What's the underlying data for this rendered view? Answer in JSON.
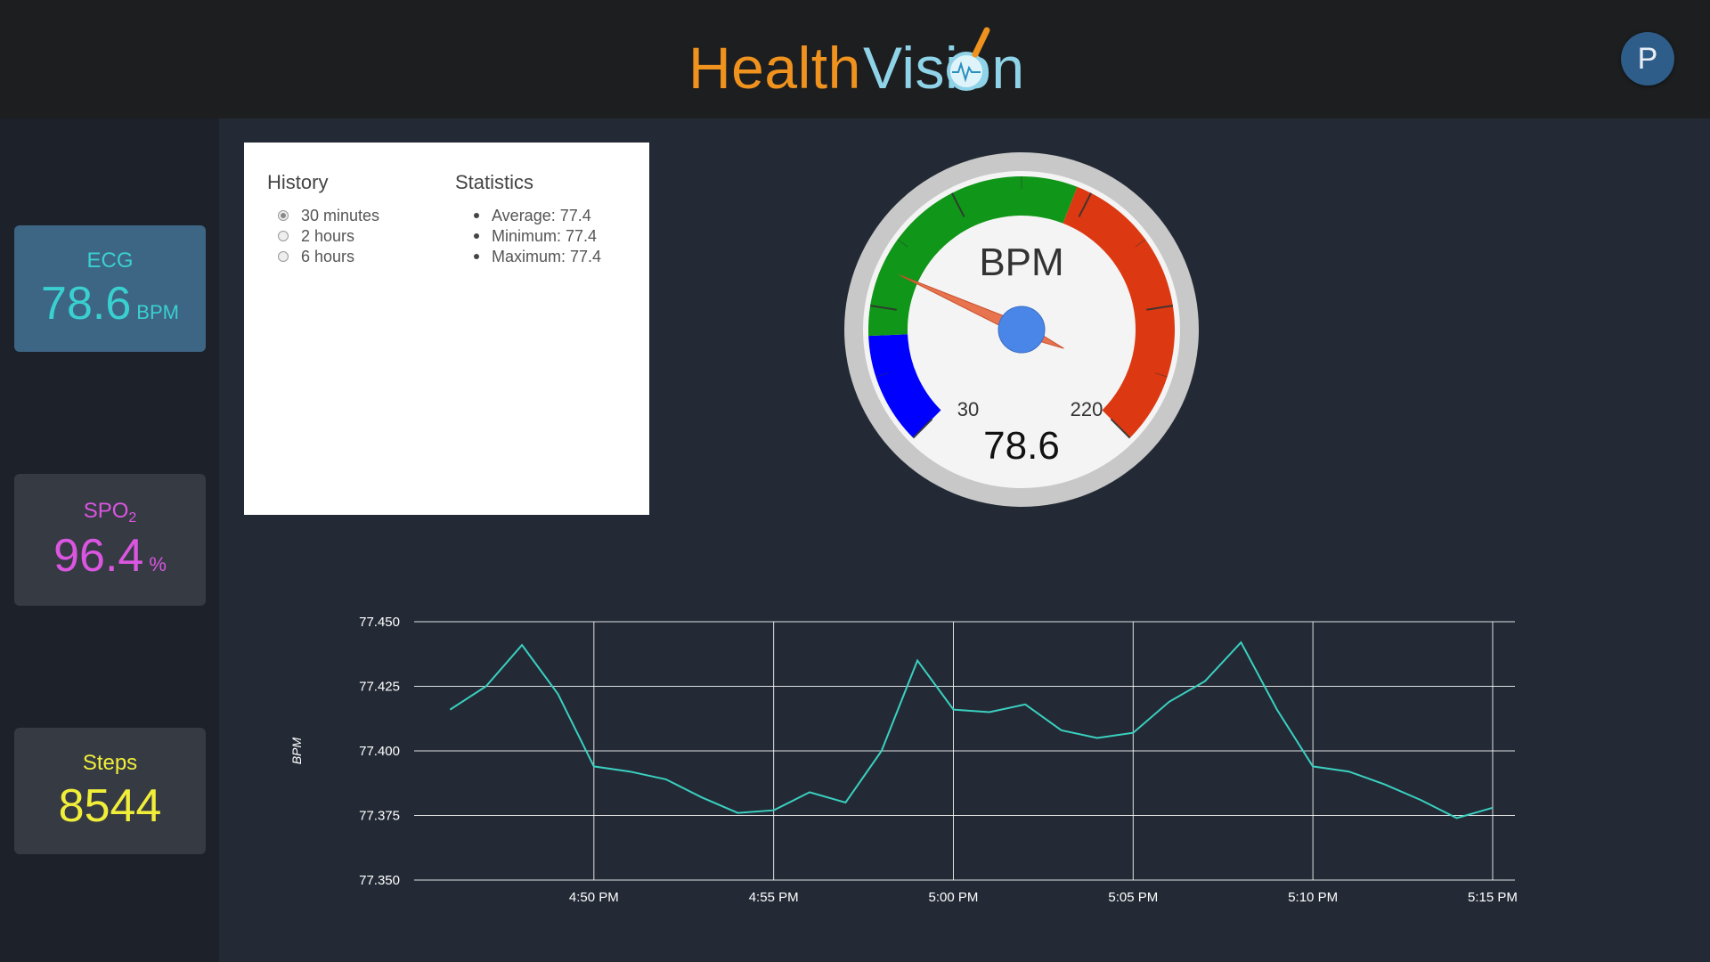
{
  "header": {
    "logo_part1": "Health",
    "logo_part2": "Vision",
    "avatar_initial": "P"
  },
  "sidebar": {
    "ecg": {
      "title": "ECG",
      "value": "78.6",
      "unit": "BPM"
    },
    "spo2": {
      "title": "SPO",
      "title_sub": "2",
      "value": "96.4",
      "unit": "%"
    },
    "steps": {
      "title": "Steps",
      "value": "8544"
    }
  },
  "panel": {
    "history_heading": "History",
    "history_options": [
      "30 minutes",
      "2 hours",
      "6 hours"
    ],
    "history_selected": 0,
    "statistics_heading": "Statistics",
    "stats": [
      "Average: 77.4",
      "Minimum: 77.4",
      "Maximum: 77.4"
    ]
  },
  "gauge": {
    "label": "BPM",
    "value": 78.6,
    "value_text": "78.6",
    "min": 30,
    "max": 220,
    "min_label": "30",
    "max_label": "220",
    "colors": {
      "low": "#0000ff",
      "normal": "#109618",
      "high": "#dc3912"
    }
  },
  "chart_data": {
    "type": "line",
    "ylabel": "BPM",
    "ylim": [
      77.35,
      77.45
    ],
    "yticks": [
      "77.450",
      "77.425",
      "77.400",
      "77.375",
      "77.350"
    ],
    "xticks": [
      "4:50 PM",
      "4:55 PM",
      "5:00 PM",
      "5:05 PM",
      "5:10 PM",
      "5:15 PM"
    ],
    "grid": true,
    "line_color": "#3ad0c0",
    "x_start": "4:46 PM",
    "x_step_minutes": 1,
    "values": [
      77.416,
      77.425,
      77.441,
      77.422,
      77.394,
      77.392,
      77.389,
      77.382,
      77.376,
      77.377,
      77.384,
      77.38,
      77.4,
      77.435,
      77.416,
      77.415,
      77.418,
      77.408,
      77.405,
      77.407,
      77.419,
      77.427,
      77.442,
      77.416,
      77.394,
      77.392,
      77.387,
      77.381,
      77.374,
      77.378
    ]
  }
}
